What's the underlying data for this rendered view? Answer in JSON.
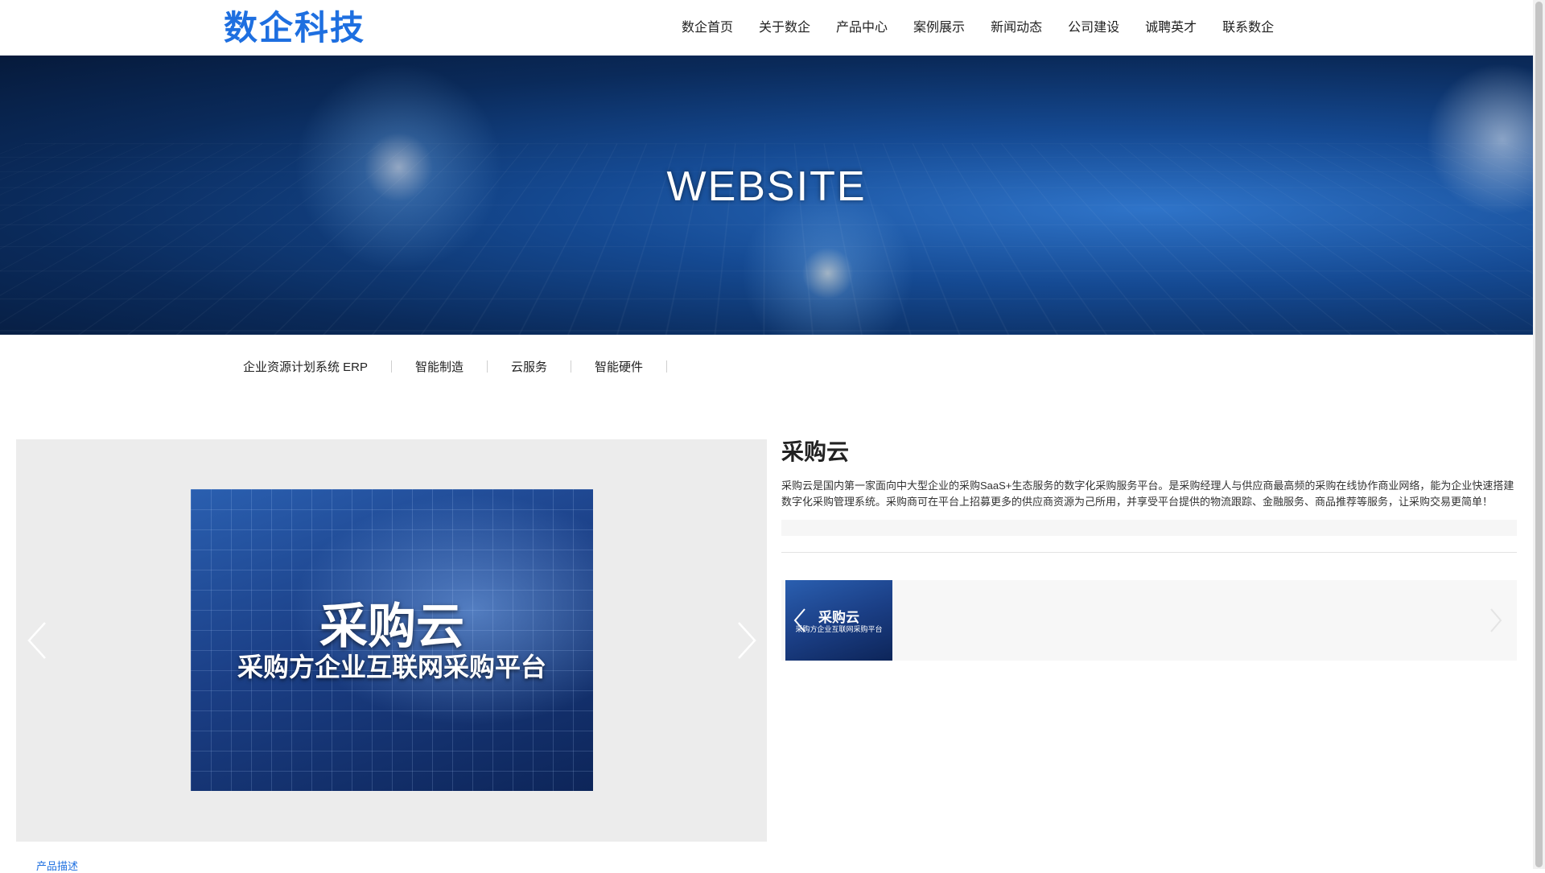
{
  "header": {
    "logo_text": "数企科技",
    "nav": [
      "数企首页",
      "关于数企",
      "产品中心",
      "案例展示",
      "新闻动态",
      "公司建设",
      "诚聘英才",
      "联系数企"
    ]
  },
  "banner": {
    "title": "WEBSITE"
  },
  "category_tabs": [
    "企业资源计划系统 ERP",
    "智能制造",
    "云服务",
    "智能硬件"
  ],
  "gallery": {
    "slide_title": "采购云",
    "slide_subtitle": "采购方企业互联网采购平台",
    "prev_icon": "chevron-left-icon",
    "next_icon": "chevron-right-icon"
  },
  "product": {
    "title": "采购云",
    "description": "采购云是国内第一家面向中大型企业的采购SaaS+生态服务的数字化采购服务平台。是采购经理人与供应商最高频的采购在线协作商业网络，能为企业快速搭建数字化采购管理系统。采购商可在平台上招募更多的供应商资源为己所用，并享受平台提供的物流跟踪、金融服务、商品推荐等服务，让采购交易更简单！"
  },
  "thumbnails": [
    {
      "title": "采购云",
      "subtitle": "采购方企业互联网采购平台"
    }
  ],
  "bottom_tab": {
    "label": "产品描述"
  },
  "colors": {
    "brand_blue": "#1e6fe0",
    "gallery_bg": "#ececec"
  }
}
